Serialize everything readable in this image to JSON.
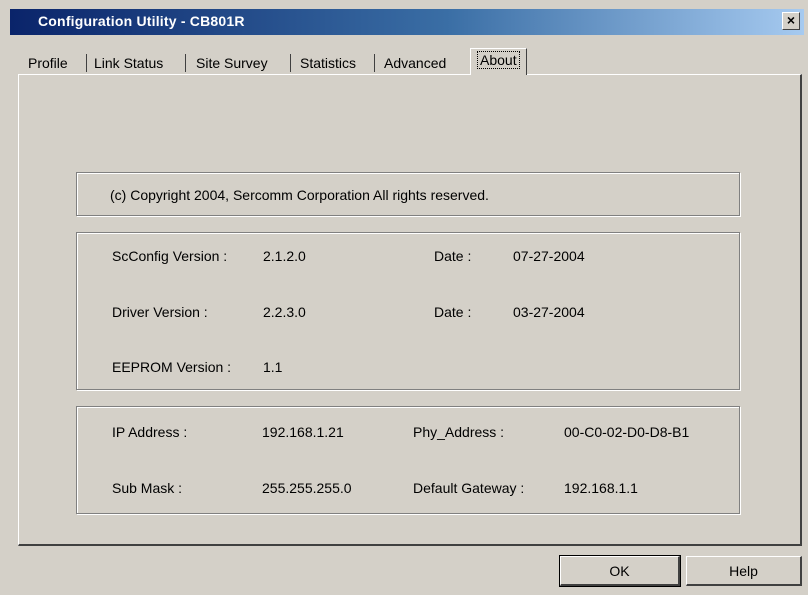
{
  "window": {
    "title": "Configuration Utility - CB801R",
    "close_glyph": "×"
  },
  "tabs": [
    {
      "label": "Profile"
    },
    {
      "label": "Link Status"
    },
    {
      "label": "Site Survey"
    },
    {
      "label": "Statistics"
    },
    {
      "label": "Advanced"
    },
    {
      "label": "About",
      "active": true
    }
  ],
  "about": {
    "copyright": "(c) Copyright 2004, Sercomm Corporation All rights reserved.",
    "versions": {
      "scconfig_label": "ScConfig Version :",
      "scconfig_value": "2.1.2.0",
      "scconfig_date_label": "Date :",
      "scconfig_date_value": "07-27-2004",
      "driver_label": "Driver Version :",
      "driver_value": "2.2.3.0",
      "driver_date_label": "Date :",
      "driver_date_value": "03-27-2004",
      "eeprom_label": "EEPROM Version :",
      "eeprom_value": "1.1"
    },
    "network": {
      "ip_label": "IP Address :",
      "ip_value": "192.168.1.21",
      "phy_label": "Phy_Address :",
      "phy_value": "00-C0-02-D0-D8-B1",
      "mask_label": "Sub Mask :",
      "mask_value": "255.255.255.0",
      "gateway_label": "Default Gateway :",
      "gateway_value": "192.168.1.1"
    }
  },
  "buttons": {
    "ok": "OK",
    "help": "Help"
  }
}
